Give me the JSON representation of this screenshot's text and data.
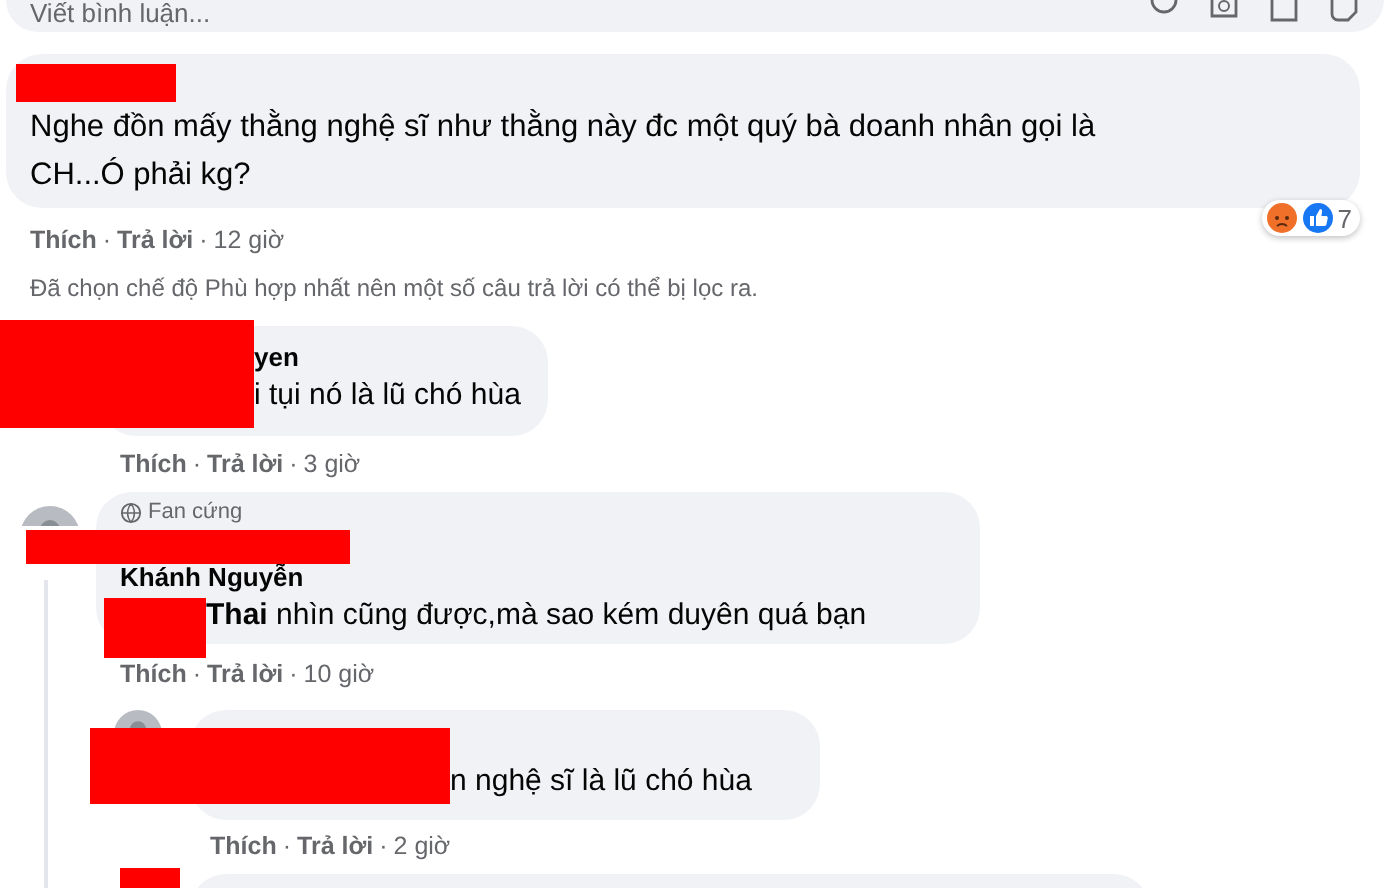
{
  "comment_box": {
    "placeholder": "Viết bình luận..."
  },
  "separator": "·",
  "comments": [
    {
      "kind": "comment",
      "text": "Nghe đồn mấy thằng nghệ sĩ như thằng này đc một quý bà doanh nhân gọi là CH...Ó phải kg?",
      "reactions": {
        "count": "7"
      },
      "like": "Thích",
      "reply": "Trả lời",
      "time": "12 giờ",
      "notice": "Đã chọn chế độ Phù hợp nhất nên một số câu trả lời có thể bị lọc ra.",
      "children": [
        {
          "kind": "reply",
          "author": "yen",
          "text": "i tụi nó là lũ chó hùa",
          "like": "Thích",
          "reply": "Trả lời",
          "time": "3 giờ"
        },
        {
          "kind": "reply",
          "badge": "Fan cứng",
          "author": "Khánh Nguyễn",
          "text": "**Thai** nhìn cũng được,mà sao kém duyên quá bạn",
          "like": "Thích",
          "reply": "Trả lời",
          "time": "10 giờ",
          "children": [
            {
              "kind": "reply",
              "text": "n nghệ sĩ là lũ chó hùa",
              "like": "Thích",
              "reply": "Trả lời",
              "time": "2 giờ"
            },
            {
              "kind": "reply"
            }
          ]
        }
      ]
    }
  ]
}
